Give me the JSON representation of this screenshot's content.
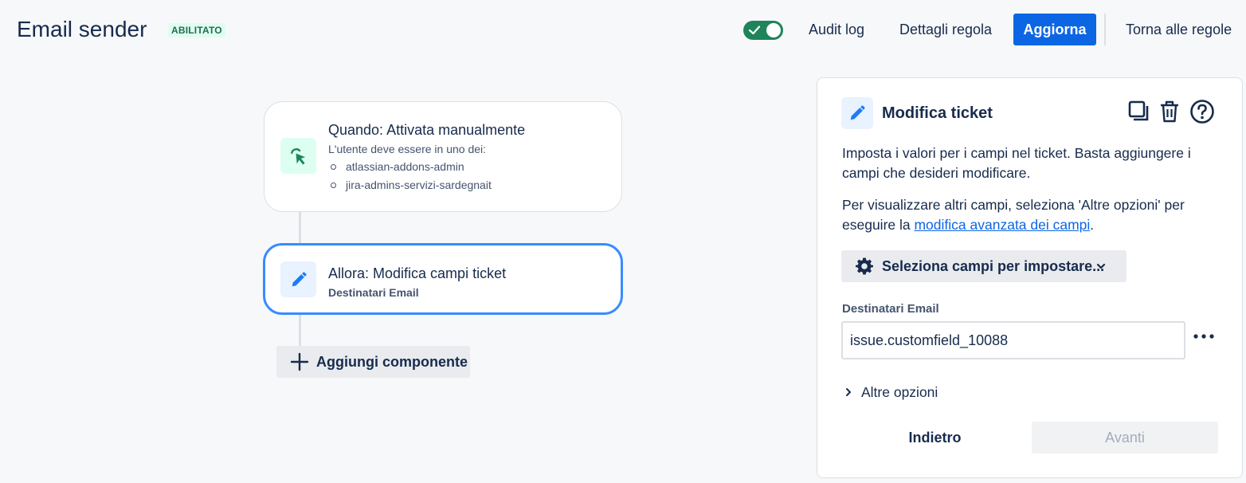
{
  "header": {
    "title": "Email sender",
    "status": "ABILITATO",
    "audit_log": "Audit log",
    "rule_details": "Dettagli regola",
    "update": "Aggiorna",
    "back_to_rules": "Torna alle regole",
    "enabled": true
  },
  "flow": {
    "trigger": {
      "title": "Quando: Attivata manualmente",
      "subtitle": "L'utente deve essere in uno dei:",
      "groups": [
        "atlassian-addons-admin",
        "jira-admins-servizi-sardegnait"
      ],
      "icon": "cursor-click-icon"
    },
    "action": {
      "title": "Allora: Modifica campi ticket",
      "subtitle": "Destinatari Email",
      "icon": "pencil-icon"
    },
    "add_component": "Aggiungi componente"
  },
  "panel": {
    "title": "Modifica ticket",
    "description": "Imposta i valori per i campi nel ticket. Basta aggiungere i campi che desideri modificare.",
    "more_fields_prefix": "Per visualizzare altri campi, seleziona 'Altre opzioni' per eseguire la ",
    "more_fields_link": "modifica avanzata dei campi",
    "more_fields_suffix": ".",
    "select_fields": "Seleziona campi per impostare...",
    "field_label": "Destinatari Email",
    "field_value": "issue.customfield_10088",
    "more_options": "Altre opzioni",
    "back": "Indietro",
    "next": "Avanti"
  },
  "colors": {
    "primary": "#0c66e4",
    "toggle_on": "#1f845a",
    "selected_border": "#388bff",
    "lozenge_bg": "#dffcf0",
    "lozenge_text": "#216e4e"
  }
}
